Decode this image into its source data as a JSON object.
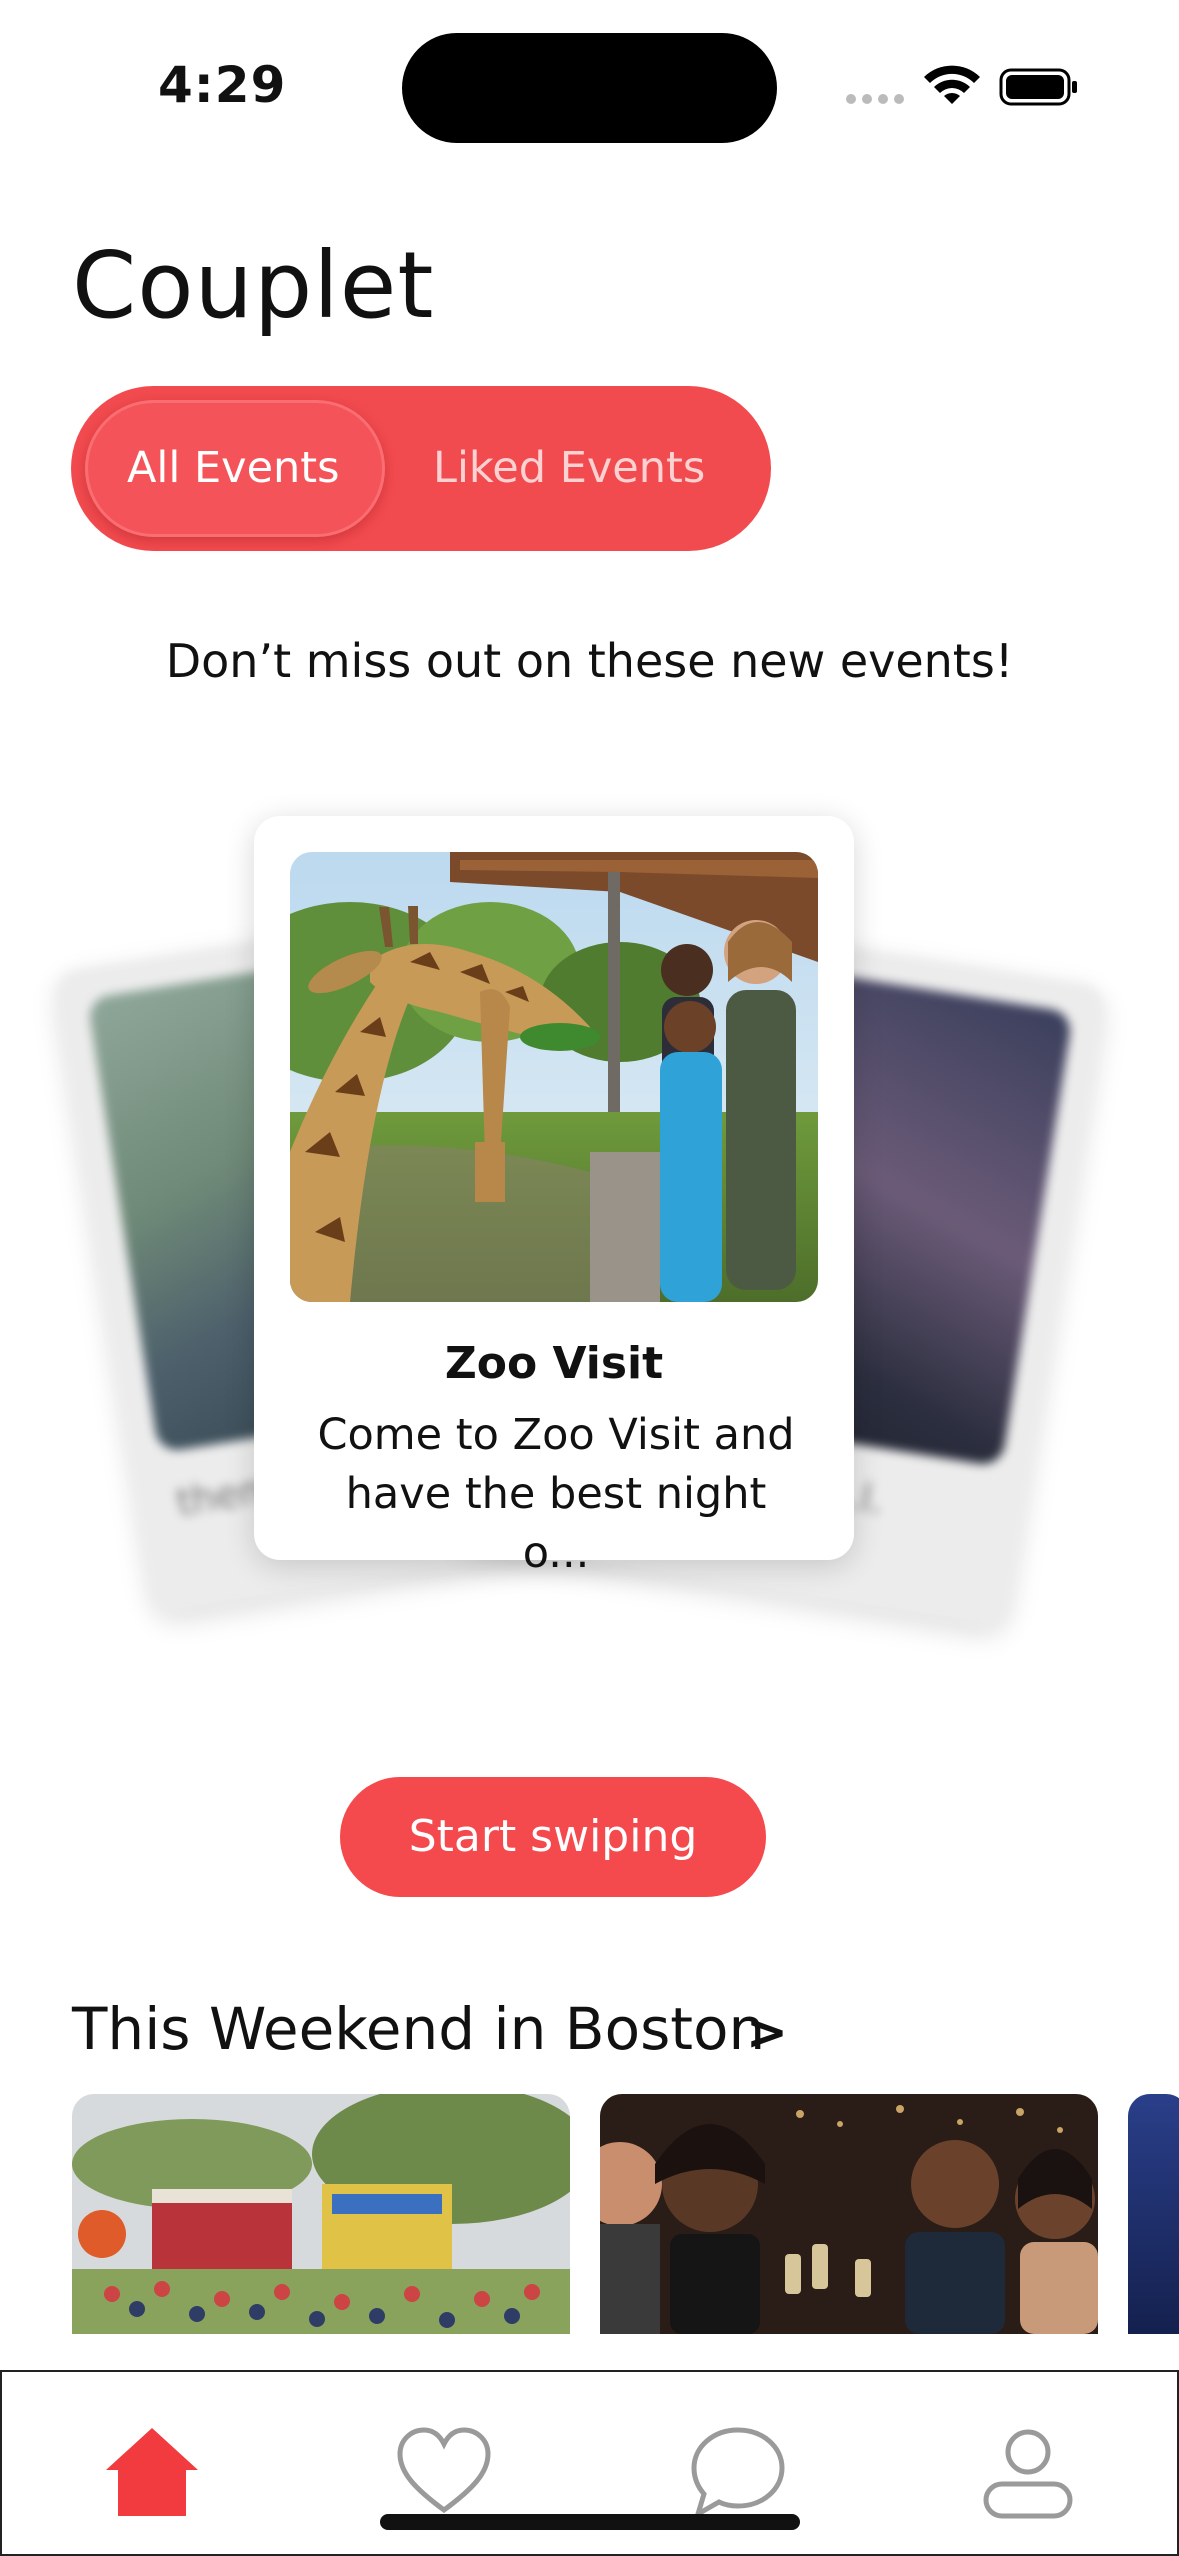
{
  "status_bar": {
    "time": "4:29",
    "signal_icon": "signal-dots-icon",
    "wifi_icon": "wifi-icon",
    "battery_icon": "battery-icon"
  },
  "app": {
    "title": "Couplet"
  },
  "segmented": {
    "all_label": "All Events",
    "liked_label": "Liked Events",
    "selected": "All Events"
  },
  "subheading": "Don’t miss out on these new events!",
  "cards": {
    "front": {
      "title": "Zoo Visit",
      "description": "Come to Zoo Visit and have the best night o..."
    },
    "back_left": {
      "text": "themed a..."
    },
    "back_right": {
      "text": "...l."
    }
  },
  "start_button": "Start swiping",
  "weekend": {
    "title": "This Weekend in Boston",
    "chevron": ">"
  },
  "tabbar": {
    "items": [
      "home-icon",
      "heart-icon",
      "chat-bubble-icon",
      "person-icon"
    ],
    "active": "home-icon"
  },
  "colors": {
    "accent": "#f44a4e",
    "accent_dark": "#f24b4f",
    "inactive_icon": "#9a9a9a"
  }
}
